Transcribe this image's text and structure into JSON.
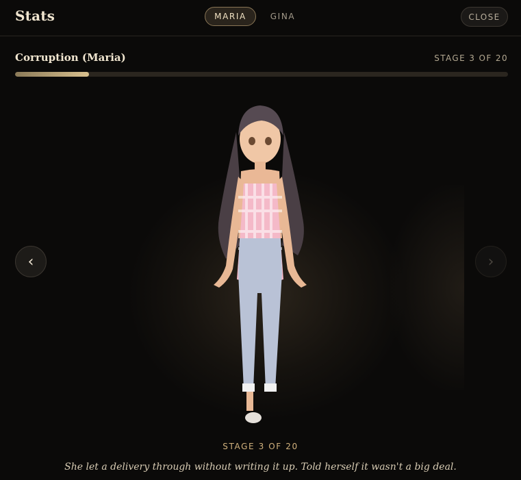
{
  "header": {
    "title": "Stats",
    "tabs": [
      {
        "label": "MARIA",
        "active": true
      },
      {
        "label": "GINA",
        "active": false
      }
    ],
    "close_label": "CLOSE"
  },
  "section": {
    "title": "Corruption (Maria)",
    "stage_label": "STAGE 3 OF 20",
    "progress_fraction": 0.15
  },
  "nav": {
    "prev_icon": "chevron-left-icon",
    "next_icon": "chevron-right-icon",
    "prev_glyph": "‹",
    "next_glyph": "›"
  },
  "stage": {
    "label": "STAGE 3 OF 20",
    "description": "She let a delivery through without writing it up. Told herself it wasn't a big deal."
  },
  "colors": {
    "accent": "#d2b27d",
    "background": "#0b0a09",
    "progress_fill": "#d9c08e"
  }
}
